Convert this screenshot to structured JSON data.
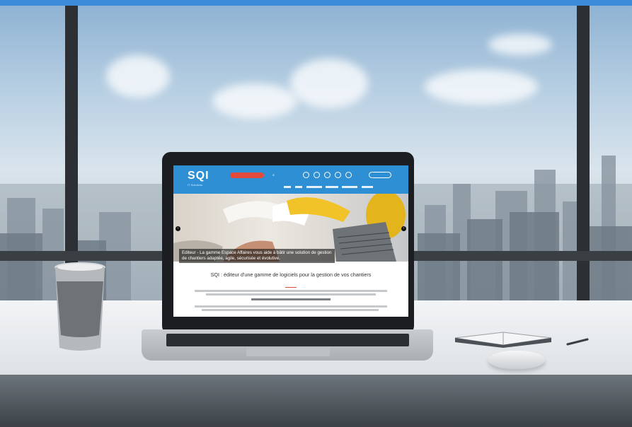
{
  "screen_site": {
    "logo": "SQI",
    "logo_sub": "IT Solutions",
    "hero_caption": "Editeur - La gamme Espace Affaires vous aide à bâtir une solution de gestion de chantiers adaptée, agile, sécurisée et évolutive.",
    "headline": "SQI : éditeur d'une gamme de logiciels pour la gestion de vos chantiers"
  },
  "colors": {
    "site_blue": "#2f8fd4",
    "accent_red": "#e24b3b",
    "top_bar": "#3a8ad8"
  },
  "icons": [
    "cup",
    "laptop",
    "notebook",
    "mouse",
    "pen",
    "arrow-left-icon",
    "arrow-right-icon",
    "phone-icon",
    "social-icon"
  ]
}
